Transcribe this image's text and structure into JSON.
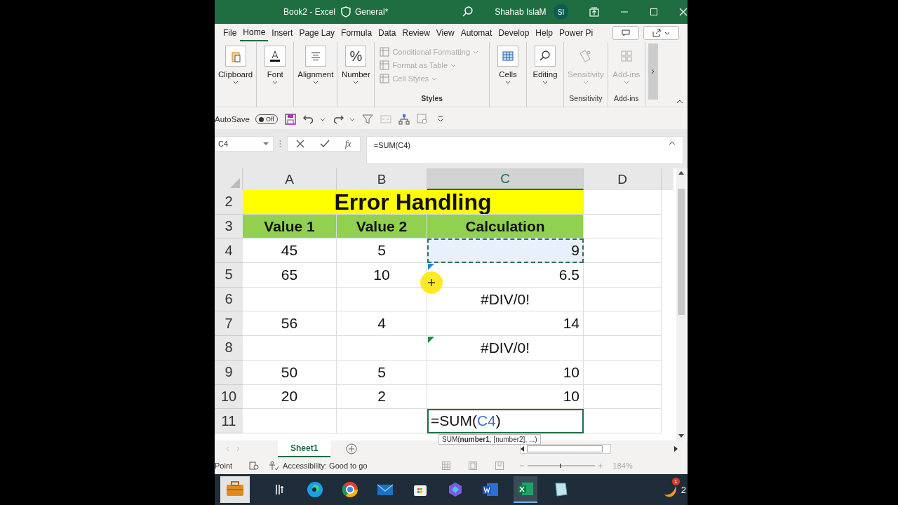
{
  "title_bar": {
    "file": "Book2  -  Excel",
    "sensitivity": "General*",
    "user": "Shahab IslaM",
    "initials": "SI"
  },
  "menu_tabs": [
    {
      "label": "File",
      "selected": false
    },
    {
      "label": "Home",
      "selected": true
    },
    {
      "label": "Insert",
      "selected": false
    },
    {
      "label": "Page Lay",
      "selected": false
    },
    {
      "label": "Formula",
      "selected": false
    },
    {
      "label": "Data",
      "selected": false
    },
    {
      "label": "Review",
      "selected": false
    },
    {
      "label": "View",
      "selected": false
    },
    {
      "label": "Automat",
      "selected": false
    },
    {
      "label": "Develop",
      "selected": false
    },
    {
      "label": "Help",
      "selected": false
    },
    {
      "label": "Power Pi",
      "selected": false
    }
  ],
  "ribbon": [
    {
      "kind": "big",
      "label": "Clipboard",
      "disabled": false
    },
    {
      "kind": "big",
      "label": "Font",
      "disabled": false
    },
    {
      "kind": "big",
      "label": "Alignment",
      "disabled": false
    },
    {
      "kind": "big",
      "label": "Number",
      "disabled": false,
      "glyph": "%"
    },
    {
      "kind": "list",
      "group_label": "Styles",
      "items": [
        {
          "label": "Conditional Formatting",
          "disabled": true
        },
        {
          "label": "Format as Table",
          "disabled": true
        },
        {
          "label": "Cell Styles",
          "disabled": true
        }
      ]
    },
    {
      "kind": "big",
      "label": "Cells",
      "disabled": false
    },
    {
      "kind": "big",
      "label": "Editing",
      "disabled": false
    },
    {
      "kind": "big",
      "label": "Sensitivity",
      "disabled": true,
      "group_label": "Sensitivity"
    },
    {
      "kind": "big",
      "label": "Add-ins",
      "disabled": true,
      "group_label": "Add-ins"
    }
  ],
  "quick_access": {
    "label": "AutoSave",
    "toggle": "Off",
    "on": false
  },
  "formula_bar": {
    "name_box": "C4",
    "fx": "fx",
    "formula": "=SUM(C4)"
  },
  "columns": [
    {
      "label": "A",
      "selected": false
    },
    {
      "label": "B",
      "selected": false
    },
    {
      "label": "C",
      "selected": true
    },
    {
      "label": "D",
      "selected": false
    }
  ],
  "rows": [
    {
      "number": "2",
      "kind": "title",
      "cells": [
        {
          "text": "Error Handling"
        }
      ]
    },
    {
      "number": "3",
      "kind": "header",
      "cells": [
        {
          "text": "Value 1"
        },
        {
          "text": "Value 2"
        },
        {
          "text": "Calculation"
        },
        {
          "text": ""
        }
      ]
    },
    {
      "number": "4",
      "kind": "data",
      "cells": [
        {
          "text": "45"
        },
        {
          "text": "5"
        },
        {
          "text": "9",
          "copied": true
        },
        {
          "text": ""
        }
      ]
    },
    {
      "number": "5",
      "kind": "data",
      "cells": [
        {
          "text": "65"
        },
        {
          "text": "10"
        },
        {
          "text": "6.5",
          "error_flag": true,
          "color": "#1e88e5"
        },
        {
          "text": ""
        }
      ]
    },
    {
      "number": "6",
      "kind": "data",
      "cells": [
        {
          "text": ""
        },
        {
          "text": ""
        },
        {
          "text": "#DIV/0!",
          "kind": "error"
        },
        {
          "text": ""
        }
      ]
    },
    {
      "number": "7",
      "kind": "data",
      "cells": [
        {
          "text": "56"
        },
        {
          "text": "4"
        },
        {
          "text": "14"
        },
        {
          "text": ""
        }
      ]
    },
    {
      "number": "8",
      "kind": "data",
      "cells": [
        {
          "text": ""
        },
        {
          "text": ""
        },
        {
          "text": "#DIV/0!",
          "kind": "error",
          "error_flag": true,
          "color": "#1d8a3a"
        },
        {
          "text": ""
        }
      ]
    },
    {
      "number": "9",
      "kind": "data",
      "cells": [
        {
          "text": "50"
        },
        {
          "text": "5"
        },
        {
          "text": "10"
        },
        {
          "text": ""
        }
      ]
    },
    {
      "number": "10",
      "kind": "data",
      "cells": [
        {
          "text": "20"
        },
        {
          "text": "2"
        },
        {
          "text": "10"
        },
        {
          "text": ""
        }
      ]
    },
    {
      "number": "11",
      "kind": "data",
      "cells": [
        {
          "text": ""
        },
        {
          "text": ""
        },
        {
          "edit": {
            "before": "=SUM(",
            "ref": "C4",
            "after": ")"
          },
          "tooltip": "SUM(**number1**, [number2], ...)"
        },
        {
          "text": ""
        }
      ]
    }
  ],
  "sheet_tabs": [
    {
      "label": "Sheet1",
      "selected": true
    }
  ],
  "status_bar": {
    "mode": "Point",
    "accessibility": "Accessibility: Good to go",
    "zoom": "184%"
  },
  "taskbar": {
    "badge": "1",
    "clock": "2"
  }
}
